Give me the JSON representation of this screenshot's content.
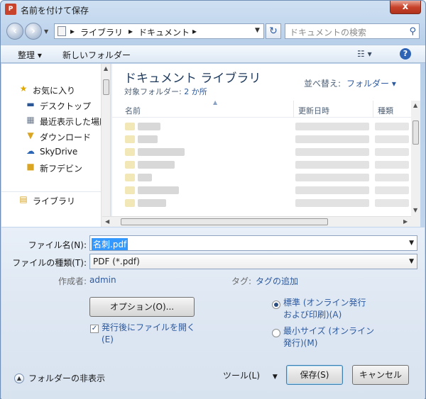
{
  "window": {
    "app_icon_text": "P",
    "title": "名前を付けて保存",
    "close_glyph": "x"
  },
  "nav": {
    "breadcrumb": [
      "ライブラリ",
      "ドキュメント"
    ],
    "search_placeholder": "ドキュメントの検索"
  },
  "toolbar": {
    "organize": "整理 ▾",
    "new_folder": "新しいフォルダー"
  },
  "sidebar": {
    "items": [
      {
        "label": "お気に入り",
        "icon": "star-icon"
      },
      {
        "label": "デスクトップ",
        "icon": "desktop-icon"
      },
      {
        "label": "最近表示した場所",
        "icon": "recent-places-icon"
      },
      {
        "label": "ダウンロード",
        "icon": "download-folder-icon"
      },
      {
        "label": "SkyDrive",
        "icon": "cloud-icon"
      },
      {
        "label": "新フデビン",
        "icon": "folder-icon"
      },
      {
        "label": "ライブラリ",
        "icon": "library-icon"
      }
    ]
  },
  "library": {
    "title": "ドキュメント ライブラリ",
    "subtitle_prefix": "対象フォルダー: ",
    "subtitle_link": "2 か所",
    "sort_label": "並べ替え:",
    "sort_value": "フォルダー ▾",
    "columns": [
      "名前",
      "更新日時",
      "種類"
    ]
  },
  "form": {
    "filename_label": "ファイル名(N):",
    "filename_value": "名刺.pdf",
    "filetype_label": "ファイルの種類(T):",
    "filetype_value": "PDF (*.pdf)",
    "author_label": "作成者:",
    "author_value": "admin",
    "tags_label": "タグ:",
    "tags_value": "タグの追加",
    "options_button": "オプション(O)...",
    "open_after_line1": "発行後にファイルを開く",
    "open_after_line2": "(E)",
    "opt_standard_line1": "標準 (オンライン発行",
    "opt_standard_line2": "および印刷)(A)",
    "opt_min_line1": "最小サイズ (オンライン",
    "opt_min_line2": "発行)(M)",
    "hide_folders": "フォルダーの非表示",
    "tools_button": "ツール(L)",
    "save_button": "保存(S)",
    "cancel_button": "キャンセル"
  }
}
